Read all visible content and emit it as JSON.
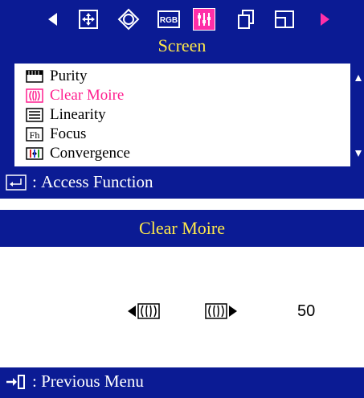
{
  "menu": {
    "tabs": [
      {
        "icon": "left-arrow-icon",
        "selected": false
      },
      {
        "icon": "position-icon",
        "selected": false
      },
      {
        "icon": "geometry-icon",
        "selected": false
      },
      {
        "icon": "rgb-icon",
        "label": "RGB",
        "selected": false
      },
      {
        "icon": "screen-adjust-icon",
        "selected": true
      },
      {
        "icon": "copy-icon",
        "selected": false
      },
      {
        "icon": "window-icon",
        "selected": false
      },
      {
        "icon": "right-arrow-icon",
        "selected": false
      }
    ],
    "title": "Screen",
    "items": [
      {
        "label": "Purity",
        "icon": "purity-icon",
        "active": false
      },
      {
        "label": "Clear Moire",
        "icon": "moire-icon",
        "active": true
      },
      {
        "label": "Linearity",
        "icon": "linearity-icon",
        "active": false
      },
      {
        "label": "Focus",
        "icon": "focus-icon",
        "icon_text": "Fh",
        "active": false
      },
      {
        "label": "Convergence",
        "icon": "convergence-icon",
        "active": false
      }
    ],
    "footer": "Access Function"
  },
  "submenu": {
    "title": "Clear Moire",
    "value": "50",
    "footer": "Previous Menu"
  },
  "colors": {
    "osd_background": "#0b1b94",
    "title_text": "#ffe94a",
    "active_item": "#ff1f8f",
    "selected_tab": "#ff2fa8",
    "right_arrow": "#ff2fa8"
  }
}
